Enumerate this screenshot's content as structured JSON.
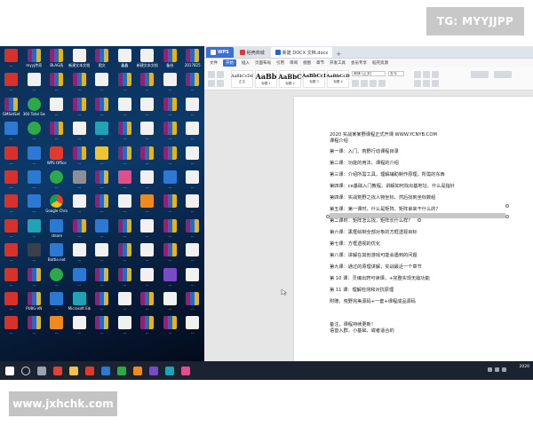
{
  "watermarks": {
    "top": "TG: MYYJJPP",
    "bottom": "www.jxhchk.com"
  },
  "desktop_icons": [
    {
      "row": 0,
      "items": [
        {
          "label": "...",
          "icon": "gc-app-icon",
          "g": "g-red"
        },
        {
          "label": "myyj传奇",
          "icon": "winrar-icon",
          "g": "g-rar"
        },
        {
          "label": "BLAG再",
          "icon": "winrar-icon",
          "g": "g-rar"
        },
        {
          "label": "新建文本文档",
          "icon": "document-icon",
          "g": "g-doc"
        },
        {
          "label": "图文",
          "icon": "winrar-icon",
          "g": "g-rar"
        },
        {
          "label": "鑫鑫",
          "icon": "document-icon",
          "g": "g-doc"
        },
        {
          "label": "新建文本文档",
          "icon": "document-icon",
          "g": "g-doc"
        },
        {
          "label": "备份",
          "icon": "winrar-icon",
          "g": "g-rar"
        },
        {
          "label": "2017825",
          "icon": "winrar-icon",
          "g": "g-rar"
        }
      ]
    },
    {
      "row": 1,
      "items": [
        {
          "label": "...",
          "icon": "gc-app-icon",
          "g": "g-red"
        },
        {
          "label": "...",
          "icon": "document-icon",
          "g": "g-doc"
        },
        {
          "label": "...",
          "icon": "winrar-icon",
          "g": "g-rar"
        },
        {
          "label": "...",
          "icon": "winrar-icon",
          "g": "g-rar"
        },
        {
          "label": "...",
          "icon": "document-icon",
          "g": "g-doc"
        },
        {
          "label": "...",
          "icon": "winrar-icon",
          "g": "g-rar"
        },
        {
          "label": "...",
          "icon": "winrar-icon",
          "g": "g-rar"
        },
        {
          "label": "...",
          "icon": "document-icon",
          "g": "g-doc"
        },
        {
          "label": "...",
          "icon": "winrar-icon",
          "g": "g-rar"
        }
      ]
    },
    {
      "row": 2,
      "items": [
        {
          "label": "GMSetSet",
          "icon": "winrar-icon",
          "g": "g-rar"
        },
        {
          "label": "360 Total Security",
          "icon": "security-icon",
          "g": "g-green"
        },
        {
          "label": "...",
          "icon": "document-icon",
          "g": "g-doc"
        },
        {
          "label": "...",
          "icon": "winrar-icon",
          "g": "g-rar"
        },
        {
          "label": "...",
          "icon": "winrar-icon",
          "g": "g-rar"
        },
        {
          "label": "...",
          "icon": "document-icon",
          "g": "g-doc"
        },
        {
          "label": "...",
          "icon": "document-icon",
          "g": "g-doc"
        },
        {
          "label": "...",
          "icon": "winrar-icon",
          "g": "g-rar"
        },
        {
          "label": "...",
          "icon": "document-icon",
          "g": "g-doc"
        }
      ]
    },
    {
      "row": 3,
      "items": [
        {
          "label": "...",
          "icon": "app-icon",
          "g": "g-blue"
        },
        {
          "label": "...",
          "icon": "app-icon",
          "g": "g-green"
        },
        {
          "label": "...",
          "icon": "winrar-icon",
          "g": "g-rar"
        },
        {
          "label": "...",
          "icon": "document-icon",
          "g": "g-doc"
        },
        {
          "label": "...",
          "icon": "app-icon",
          "g": "g-teal"
        },
        {
          "label": "...",
          "icon": "winrar-icon",
          "g": "g-rar"
        },
        {
          "label": "...",
          "icon": "document-icon",
          "g": "g-doc"
        },
        {
          "label": "...",
          "icon": "winrar-icon",
          "g": "g-rar"
        },
        {
          "label": "...",
          "icon": "document-icon",
          "g": "g-doc"
        }
      ]
    },
    {
      "row": 4,
      "items": [
        {
          "label": "...",
          "icon": "app-icon",
          "g": "g-red"
        },
        {
          "label": "...",
          "icon": "app-icon",
          "g": "g-blue"
        },
        {
          "label": "WPS Office",
          "icon": "wps-icon",
          "g": "g-wps"
        },
        {
          "label": "...",
          "icon": "winrar-icon",
          "g": "g-rar"
        },
        {
          "label": "...",
          "icon": "app-icon",
          "g": "g-yellow"
        },
        {
          "label": "...",
          "icon": "winrar-icon",
          "g": "g-rar"
        },
        {
          "label": "...",
          "icon": "winrar-icon",
          "g": "g-rar"
        },
        {
          "label": "...",
          "icon": "winrar-icon",
          "g": "g-rar"
        },
        {
          "label": "...",
          "icon": "document-icon",
          "g": "g-doc"
        }
      ]
    },
    {
      "row": 5,
      "items": [
        {
          "label": "...",
          "icon": "app-icon",
          "g": "g-red"
        },
        {
          "label": "...",
          "icon": "app-icon",
          "g": "g-blue"
        },
        {
          "label": "...",
          "icon": "app-icon",
          "g": "g-green"
        },
        {
          "label": "...",
          "icon": "app-icon",
          "g": "g-gray"
        },
        {
          "label": "...",
          "icon": "winrar-icon",
          "g": "g-rar"
        },
        {
          "label": "...",
          "icon": "app-icon",
          "g": "g-pink"
        },
        {
          "label": "...",
          "icon": "document-icon",
          "g": "g-doc"
        },
        {
          "label": "...",
          "icon": "app-icon",
          "g": "g-blue"
        },
        {
          "label": "...",
          "icon": "document-icon",
          "g": "g-doc"
        }
      ]
    },
    {
      "row": 6,
      "items": [
        {
          "label": "...",
          "icon": "gc-app-icon",
          "g": "g-red"
        },
        {
          "label": "...",
          "icon": "app-icon",
          "g": "g-blue"
        },
        {
          "label": "Google Chrome",
          "icon": "chrome-icon",
          "g": "g-chrome"
        },
        {
          "label": "...",
          "icon": "document-icon",
          "g": "g-doc"
        },
        {
          "label": "...",
          "icon": "winrar-icon",
          "g": "g-rar"
        },
        {
          "label": "...",
          "icon": "document-icon",
          "g": "g-doc"
        },
        {
          "label": "...",
          "icon": "app-icon",
          "g": "g-orange"
        },
        {
          "label": "...",
          "icon": "winrar-icon",
          "g": "g-rar"
        },
        {
          "label": "...",
          "icon": "document-icon",
          "g": "g-doc"
        }
      ]
    },
    {
      "row": 7,
      "items": [
        {
          "label": "...",
          "icon": "gc-app-icon",
          "g": "g-red"
        },
        {
          "label": "...",
          "icon": "app-icon",
          "g": "g-teal"
        },
        {
          "label": "steam",
          "icon": "steam-icon",
          "g": "g-blue"
        },
        {
          "label": "...",
          "icon": "winrar-icon",
          "g": "g-rar"
        },
        {
          "label": "...",
          "icon": "app-icon",
          "g": "g-blue"
        },
        {
          "label": "...",
          "icon": "winrar-icon",
          "g": "g-rar"
        },
        {
          "label": "...",
          "icon": "document-icon",
          "g": "g-doc"
        },
        {
          "label": "...",
          "icon": "winrar-icon",
          "g": "g-rar"
        },
        {
          "label": "...",
          "icon": "winrar-icon",
          "g": "g-rar"
        }
      ]
    },
    {
      "row": 8,
      "items": [
        {
          "label": "...",
          "icon": "gc-app-icon",
          "g": "g-red"
        },
        {
          "label": "...",
          "icon": "app-icon",
          "g": "g-dark"
        },
        {
          "label": "Battle.net",
          "icon": "battlenet-icon",
          "g": "g-blue"
        },
        {
          "label": "...",
          "icon": "document-icon",
          "g": "g-doc"
        },
        {
          "label": "...",
          "icon": "document-icon",
          "g": "g-doc"
        },
        {
          "label": "...",
          "icon": "winrar-icon",
          "g": "g-rar"
        },
        {
          "label": "...",
          "icon": "document-icon",
          "g": "g-doc"
        },
        {
          "label": "...",
          "icon": "winrar-icon",
          "g": "g-rar"
        },
        {
          "label": "...",
          "icon": "document-icon",
          "g": "g-doc"
        }
      ]
    },
    {
      "row": 9,
      "items": [
        {
          "label": "...",
          "icon": "gc-app-icon",
          "g": "g-red"
        },
        {
          "label": "...",
          "icon": "winrar-icon",
          "g": "g-rar"
        },
        {
          "label": "...",
          "icon": "app-icon",
          "g": "g-green"
        },
        {
          "label": "...",
          "icon": "app-icon",
          "g": "g-blue"
        },
        {
          "label": "...",
          "icon": "winrar-icon",
          "g": "g-rar"
        },
        {
          "label": "...",
          "icon": "winrar-icon",
          "g": "g-rar"
        },
        {
          "label": "...",
          "icon": "document-icon",
          "g": "g-doc"
        },
        {
          "label": "...",
          "icon": "app-icon",
          "g": "g-purple"
        },
        {
          "label": "...",
          "icon": "document-icon",
          "g": "g-doc"
        }
      ]
    },
    {
      "row": 10,
      "items": [
        {
          "label": "...",
          "icon": "gc-app-icon",
          "g": "g-red"
        },
        {
          "label": "PUBG-VN",
          "icon": "winrar-icon",
          "g": "g-rar"
        },
        {
          "label": "...",
          "icon": "app-icon",
          "g": "g-blue"
        },
        {
          "label": "Microsoft Edge",
          "icon": "edge-icon",
          "g": "g-teal"
        },
        {
          "label": "...",
          "icon": "winrar-icon",
          "g": "g-rar"
        },
        {
          "label": "...",
          "icon": "document-icon",
          "g": "g-doc"
        },
        {
          "label": "...",
          "icon": "winrar-icon",
          "g": "g-rar"
        },
        {
          "label": "...",
          "icon": "document-icon",
          "g": "g-doc"
        },
        {
          "label": "...",
          "icon": "winrar-icon",
          "g": "g-rar"
        }
      ]
    },
    {
      "row": 11,
      "items": [
        {
          "label": "...",
          "icon": "gc-app-icon",
          "g": "g-red"
        },
        {
          "label": "...",
          "icon": "winrar-icon",
          "g": "g-rar"
        },
        {
          "label": "...",
          "icon": "app-icon",
          "g": "g-orange"
        },
        {
          "label": "...",
          "icon": "document-icon",
          "g": "g-doc"
        },
        {
          "label": "...",
          "icon": "winrar-icon",
          "g": "g-rar"
        },
        {
          "label": "...",
          "icon": "document-icon",
          "g": "g-doc"
        },
        {
          "label": "...",
          "icon": "winrar-icon",
          "g": "g-rar"
        },
        {
          "label": "...",
          "icon": "winrar-icon",
          "g": "g-rar"
        },
        {
          "label": "...",
          "icon": "document-icon",
          "g": "g-doc"
        }
      ]
    }
  ],
  "wps": {
    "tabs": [
      {
        "label": "WPS",
        "kind": "home"
      },
      {
        "label": "稻壳商城",
        "kind": "other"
      },
      {
        "label": "新建 DOCX 文档.docx",
        "kind": "doc"
      }
    ],
    "menu": [
      "文件",
      "开始",
      "插入",
      "页面布局",
      "引用",
      "审阅",
      "视图",
      "章节",
      "开发工具",
      "会员专享",
      "稻壳资源"
    ],
    "active_menu": "开始",
    "font_name": "宋体 (正文)",
    "font_size": "五号",
    "styles": [
      {
        "sample": "AaBbCcDd",
        "name": "正文"
      },
      {
        "sample": "AaBb",
        "name": "标题 1"
      },
      {
        "sample": "AaBbC",
        "name": "标题 2"
      },
      {
        "sample": "AaBbCcI",
        "name": "标题 3"
      },
      {
        "sample": "AaBbCcD",
        "name": "标题 4"
      }
    ],
    "doc_lines": [
      "2020  实战某某野课程正式开课 WWW.YCNYB.COM",
      "课程介绍",
      "第一课：入门、荒野行动课程目录",
      "第二课：功能的用法、课程的介绍",
      "第三课：介绍所需工具，理解辅助制作原理，所需的东西",
      "第四课：ce基础入门教程，讲解如何找出基地址、什么是指针",
      "第四课：实战荒野之找人物坐标、然后找到坐标数组",
      "第五课：第一课时，什么是矩阵，矩阵拿来干什么的？",
      "第二课时：矩阵怎么找，矩阵长什么样？",
      "第六课：黑框绘制全部对象的方框透视目标",
      "第七课：方框透视的优化",
      "第八课：讲解在其他游戏可能会遇到的问题",
      "第九课：通过的原理讲解，实战最近一个章节",
      "第 10 课：灵魂出窍可读课，+完整实现无敌功能",
      "第 11 课：理解检测和对抗原理",
      "附赠，荒野完美源码+一套+课程成品源码",
      "",
      "备注，课程持续更新！",
      "语音入群，小基础、或者适合的"
    ]
  },
  "taskbar": {
    "items": [
      "start-icon",
      "search-icon",
      "task-view-icon",
      "chrome-icon",
      "explorer-icon",
      "wps-icon",
      "app-icon",
      "app-icon",
      "app-icon",
      "app-icon",
      "app-icon",
      "app-icon"
    ],
    "clock_time": "",
    "clock_date": "2020"
  },
  "colors": {
    "accent": "#3b6fd8",
    "desktop_bg": "#0b3a6b",
    "taskbar": "#1c2330"
  }
}
